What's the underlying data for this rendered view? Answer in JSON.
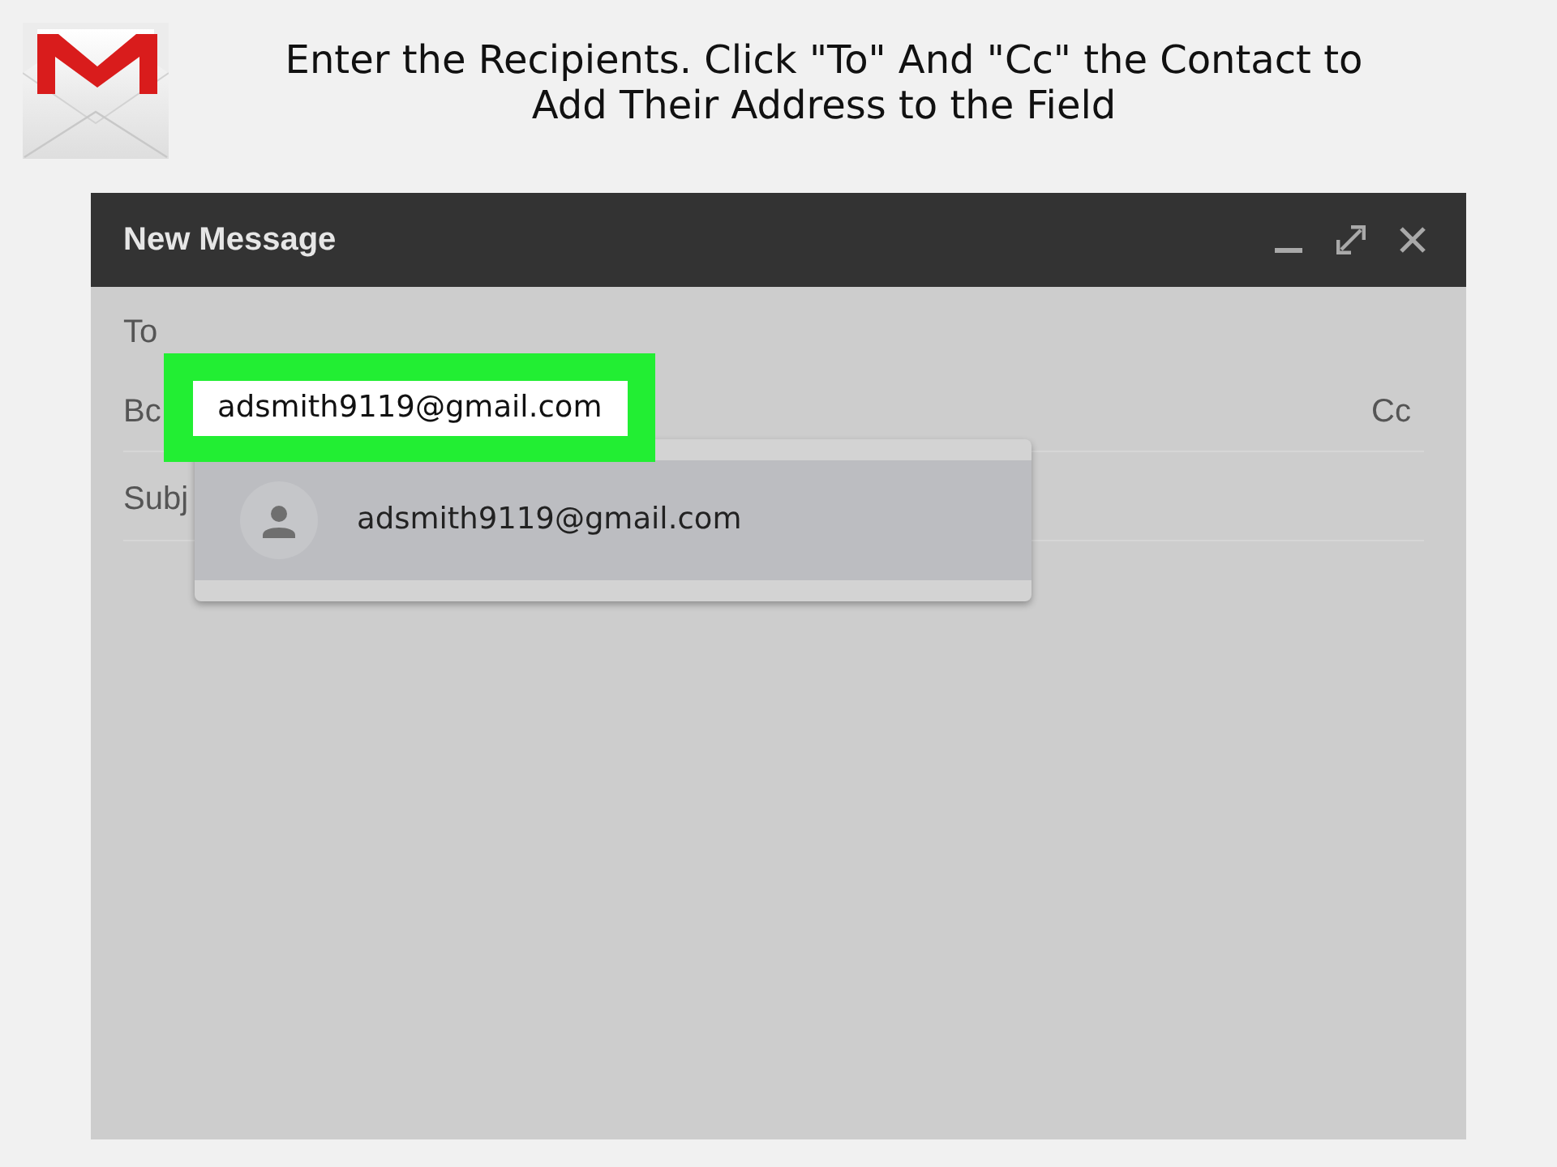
{
  "caption": "Enter the Recipients. Click \"To\" And \"Cc\" the Contact to Add Their Address to the Field",
  "window": {
    "title": "New Message"
  },
  "compose": {
    "to_label": "To",
    "bcc_label": "Bc",
    "cc_label": "Cc",
    "subject": {
      "placeholder": "Subj"
    }
  },
  "recipient_input": {
    "value": "adsmith9119@gmail.com",
    "highlighted": true
  },
  "suggestions": [
    {
      "email": "adsmith9119@gmail.com",
      "selected": true
    }
  ]
}
